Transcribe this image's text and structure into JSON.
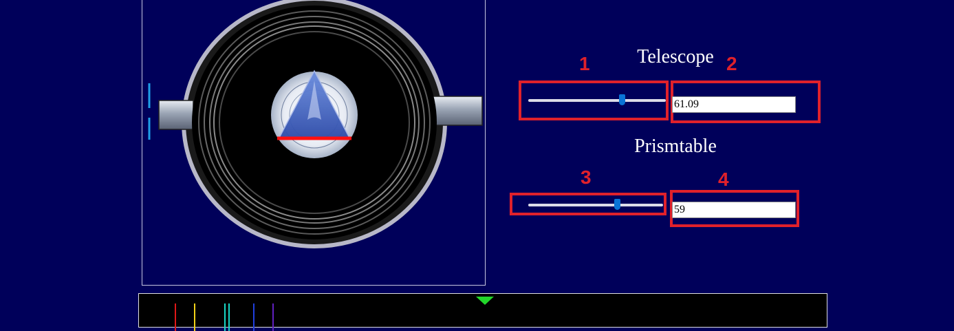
{
  "telescope": {
    "title": "Telescope",
    "value": "61.09",
    "slider_fraction": 0.68
  },
  "prismtable": {
    "title": "Prismtable",
    "value": "59",
    "slider_fraction": 0.66
  },
  "annotations": [
    "1",
    "2",
    "3",
    "4"
  ],
  "colors": {
    "background": "#00005a",
    "annotation": "#e0212b",
    "slider_thumb": "#0a74d6",
    "marker": "#22d62a"
  },
  "spectrum_lines": [
    "#e01818",
    "#f2d218",
    "#18d8c8",
    "#18d8c8",
    "#2040e0",
    "#6020c0"
  ]
}
